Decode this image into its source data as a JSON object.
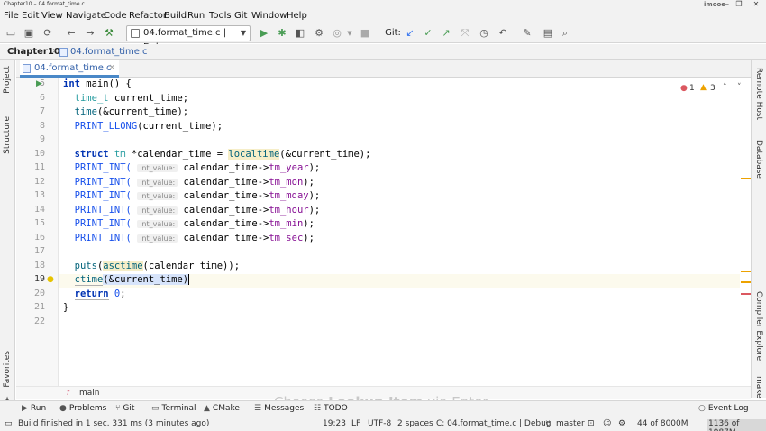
{
  "window": {
    "title": "Chapter10 – 04.format_time.c",
    "brand": "imooc",
    "minimize": "—",
    "restore": "❐",
    "close": "✕"
  },
  "menu": [
    "File",
    "Edit",
    "View",
    "Navigate",
    "Code",
    "Refactor",
    "Build",
    "Run",
    "Tools",
    "Git",
    "Window",
    "Help"
  ],
  "toolbar": {
    "run_config": "04.format_time.c | Debug",
    "git_label": "Git:"
  },
  "breadcrumb": {
    "project": "Chapter10",
    "file": "04.format_time.c"
  },
  "left_tools": {
    "project": "Project",
    "structure": "Structure",
    "favorites": "Favorites"
  },
  "right_tools": {
    "remote_host": "Remote Host",
    "database": "Database",
    "compiler_explorer": "Compiler Explorer",
    "make": "make"
  },
  "tab": {
    "label": "04.format_time.c",
    "close": "×"
  },
  "indicators": {
    "errors": "1",
    "warnings": "3"
  },
  "code": {
    "line_numbers": [
      "5",
      "6",
      "7",
      "8",
      "9",
      "10",
      "11",
      "12",
      "13",
      "14",
      "15",
      "16",
      "17",
      "18",
      "19",
      "20",
      "21",
      "22"
    ],
    "hint": "int_value:",
    "l5": {
      "kw": "int",
      "rest": " main() {"
    },
    "l6": {
      "ty": "time_t",
      "rest": " current_time;"
    },
    "l7": {
      "fn": "time",
      "rest": "(&current_time);"
    },
    "l8": {
      "mac": "PRINT_LLONG",
      "rest": "(current_time);"
    },
    "l10": {
      "kw": "struct",
      "ty": "tm",
      "mid": " *calendar_time = ",
      "fn": "localtime",
      "rest": "(&current_time);"
    },
    "print_int": "PRINT_INT(",
    "arrow_prefix": "calendar_time->",
    "fields": [
      "tm_year",
      "tm_mon",
      "tm_mday",
      "tm_hour",
      "tm_min",
      "tm_sec"
    ],
    "close": ");",
    "l18": {
      "fn": "puts",
      "open": "(",
      "fn2": "asctime",
      "rest": "(calendar_time));"
    },
    "l19": {
      "fn": "ctime",
      "sel": "(&current_time)"
    },
    "l20": {
      "kw": "return",
      "num": "0",
      "rest": ";"
    },
    "l21": {
      "rest": "}"
    }
  },
  "editor_footer": {
    "scope": "main"
  },
  "bottom_tabs": [
    "Run",
    "Problems",
    "Git",
    "Terminal",
    "CMake",
    "Messages",
    "TODO"
  ],
  "event_log": "Event Log",
  "overlay": {
    "part1": "Choose ",
    "part2": "Lookup Item",
    "part3": " via Enter"
  },
  "status": {
    "message": "Build finished in 1 sec, 331 ms (3 minutes ago)",
    "position": "19:23",
    "line_sep": "LF",
    "encoding": "UTF-8",
    "indent": "2 spaces",
    "context": "C: 04.format_time.c | Debug",
    "branch": "master",
    "memory": "44 of 8000M",
    "extra": "1136 of 1987M"
  },
  "colors": {
    "accent": "#4a88c7",
    "error": "#db5860",
    "warning": "#eda200",
    "run_green": "#499c54"
  }
}
